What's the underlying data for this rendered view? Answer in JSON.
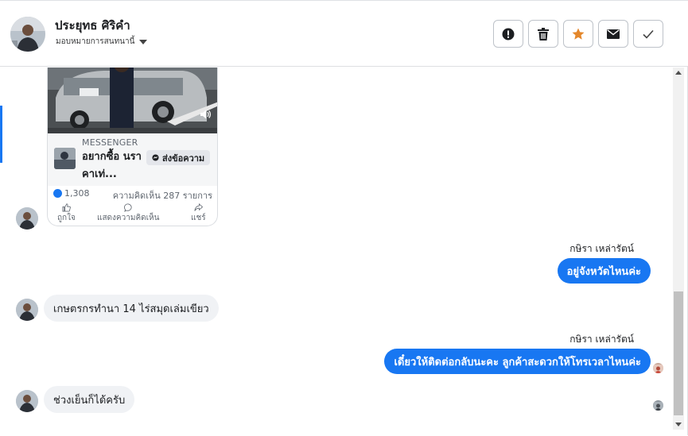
{
  "header": {
    "contact_name": "ประยุทธ ศิริคำ",
    "assign_label": "มอบหมายการสนทนานี้",
    "actions": [
      {
        "name": "spam-button",
        "icon": "exclamation-icon"
      },
      {
        "name": "delete-button",
        "icon": "trash-icon"
      },
      {
        "name": "star-button",
        "icon": "star-icon"
      },
      {
        "name": "mark-unread-button",
        "icon": "envelope-icon"
      },
      {
        "name": "mark-done-button",
        "icon": "checkmark-icon"
      }
    ]
  },
  "ad_card": {
    "source": "MESSENGER",
    "title": "อยากซื้อ นราคาเท่...",
    "cta_label": "ส่งข้อความ",
    "likes": "1,308",
    "comments": "ความคิดเห็น 287 รายการ",
    "actions": [
      "ถูกใจ",
      "แสดงความคิดเห็น",
      "แชร์"
    ]
  },
  "messages": [
    {
      "direction": "out",
      "sender": "กษิรา เหล่ารัตน์",
      "text": "อยู่จังหวัดไหนค่ะ"
    },
    {
      "direction": "in",
      "text": "เกษตรกรทำนา 14 ไร่สมุดเล่มเขียว"
    },
    {
      "direction": "out",
      "sender": "กษิรา เหล่ารัตน์",
      "text": "เดี๋ยวให้ติดต่อกลับนะคะ ลูกค้าสะดวกให้โทรเวลาไหนค่ะ"
    },
    {
      "direction": "in",
      "text": "ช่วงเย็นก็ได้ครับ"
    }
  ],
  "colors": {
    "accent": "#1877f2",
    "incoming_bubble": "#f0f2f5",
    "star": "#e4872b"
  }
}
